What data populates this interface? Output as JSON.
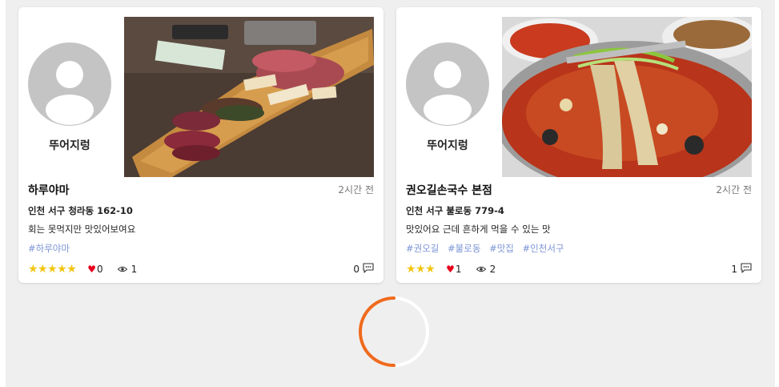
{
  "posts": [
    {
      "nickname": "뚜어지렁",
      "title": "하루야마",
      "time": "2시간 전",
      "address": "인천 서구 청라동 162-10",
      "description": "회는 못먹지만 맛있어보여요",
      "tags": [
        "#하루야마"
      ],
      "rating_stars": "★★★★★",
      "rating": 5,
      "likes": "0",
      "views": "1",
      "comments": "0",
      "photo_icon": "sashimi-board-photo"
    },
    {
      "nickname": "뚜어지렁",
      "title": "권오길손국수 본점",
      "time": "2시간 전",
      "address": "인천 서구 불로동 779-4",
      "description": "맛있어요 근데 흔하게 먹을 수 있는 맛",
      "tags": [
        "#권오길",
        "#불로동",
        "#맛집",
        "#인천서구"
      ],
      "rating_stars": "★★★",
      "rating": 3,
      "likes": "1",
      "views": "2",
      "comments": "1",
      "photo_icon": "spicy-noodles-photo"
    }
  ],
  "colors": {
    "star": "#f2c511",
    "heart": "#e8001c",
    "tag": "#7d95d6",
    "spinner": "#f06a1d",
    "background": "#efefef"
  }
}
